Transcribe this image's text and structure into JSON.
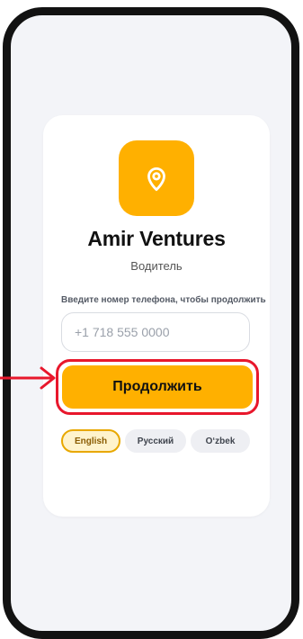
{
  "app": {
    "title": "Amir Ventures",
    "role": "Водитель",
    "logo_icon": "map-pin-icon",
    "brand_color": "#ffb000"
  },
  "login": {
    "prompt": "Введите номер телефона, чтобы продолжить",
    "phone_placeholder": "+1 718 555 0000",
    "phone_value": "",
    "continue_label": "Продолжить"
  },
  "languages": {
    "selected": "English",
    "options": [
      "English",
      "Русский",
      "O‘zbek"
    ]
  },
  "annotation": {
    "color": "#e8172c",
    "target": "continue-button"
  }
}
